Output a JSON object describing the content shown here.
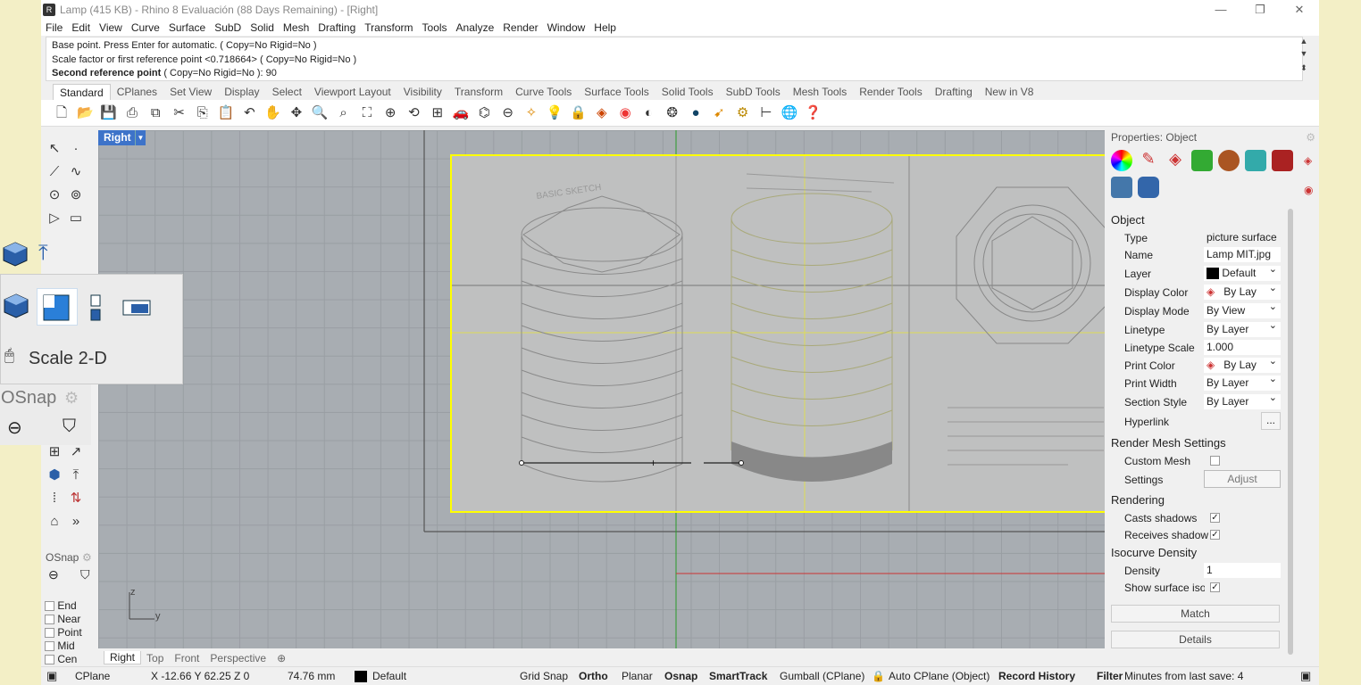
{
  "window": {
    "title": "Lamp (415 KB) - Rhino 8 Evaluación (88 Days Remaining) - [Right]",
    "controls": [
      "—",
      "❐",
      "✕"
    ]
  },
  "menu": [
    "File",
    "Edit",
    "View",
    "Curve",
    "Surface",
    "SubD",
    "Solid",
    "Mesh",
    "Drafting",
    "Transform",
    "Tools",
    "Analyze",
    "Render",
    "Window",
    "Help"
  ],
  "command": {
    "line1": "Base point. Press Enter for automatic. ( Copy=No  Rigid=No )",
    "line2": "Scale factor or first reference point <0.718664> ( Copy=No  Rigid=No )",
    "prompt_bold": "Second reference point",
    "prompt_rest": " ( Copy=No  Rigid=No ): 90"
  },
  "toolbar_tabs": [
    "Standard",
    "CPlanes",
    "Set View",
    "Display",
    "Select",
    "Viewport Layout",
    "Visibility",
    "Transform",
    "Curve Tools",
    "Surface Tools",
    "Solid Tools",
    "SubD Tools",
    "Mesh Tools",
    "Render Tools",
    "Drafting",
    "New in V8"
  ],
  "toolbar_icons": [
    "new-icon",
    "open-icon",
    "save-icon",
    "print-icon",
    "import-icon",
    "cut-icon",
    "copy-icon",
    "paste-icon",
    "undo-icon",
    "pan-icon",
    "rotate-icon",
    "zoom-icon",
    "zoom-window-icon",
    "zoom-extents-icon",
    "zoom-selected-icon",
    "rotate-view-icon",
    "four-view-icon",
    "car-icon",
    "mesh-icon",
    "cplane-icon",
    "osnap-icon",
    "light-icon",
    "lock-icon",
    "layer-icon",
    "color-wheel-icon",
    "material-icon",
    "environment-icon",
    "render-sphere-icon",
    "cursor-icon",
    "gear-icon",
    "dimension-icon",
    "globe-icon",
    "help-icon"
  ],
  "viewport": {
    "name": "Right",
    "tabs": [
      "Right",
      "Top",
      "Front",
      "Perspective"
    ],
    "axis_z": "z",
    "axis_y": "y"
  },
  "flyout": {
    "label": "Scale 2-D",
    "osnap_label": "OSnap"
  },
  "osnap": {
    "title": "OSnap",
    "items": [
      "End",
      "Near",
      "Point",
      "Mid",
      "Cen"
    ]
  },
  "status": {
    "cplane": "CPlane",
    "coords": "X -12.66 Y 62.25 Z 0",
    "distance": "74.76 mm",
    "layer": "Default",
    "grid_snap": "Grid Snap",
    "ortho": "Ortho",
    "planar": "Planar",
    "osnap": "Osnap",
    "smarttrack": "SmartTrack",
    "gumball": "Gumball (CPlane)",
    "auto_cplane": "Auto CPlane (Object)",
    "record_history": "Record History",
    "filter": "Filter",
    "minutes": "Minutes from last save: 4"
  },
  "properties": {
    "header": "Properties: Object",
    "object_section": "Object",
    "type_label": "Type",
    "type_value": "picture surface",
    "name_label": "Name",
    "name_value": "Lamp MIT.jpg",
    "layer_label": "Layer",
    "layer_value": "Default",
    "display_color_label": "Display Color",
    "display_color_value": "By Lay",
    "display_mode_label": "Display Mode",
    "display_mode_value": "By View",
    "linetype_label": "Linetype",
    "linetype_value": "By Layer",
    "linetype_scale_label": "Linetype Scale",
    "linetype_scale_value": "1.000",
    "print_color_label": "Print Color",
    "print_color_value": "By Lay",
    "print_width_label": "Print Width",
    "print_width_value": "By Layer",
    "section_style_label": "Section Style",
    "section_style_value": "By Layer",
    "hyperlink_label": "Hyperlink",
    "hyperlink_btn": "...",
    "render_mesh_section": "Render Mesh Settings",
    "custom_mesh_label": "Custom Mesh",
    "settings_label": "Settings",
    "adjust_btn": "Adjust",
    "rendering_section": "Rendering",
    "casts_shadows_label": "Casts shadows",
    "receives_shadow_label": "Receives shadow",
    "isocurve_section": "Isocurve Density",
    "density_label": "Density",
    "density_value": "1",
    "show_iso_label": "Show surface isoc",
    "match_btn": "Match",
    "details_btn": "Details"
  },
  "sketch_text": {
    "basic_sketch": "BASIC SKETCH"
  },
  "colors": {
    "viewport_bg": "#a8adb2",
    "selection": "#ffff00",
    "viewport_tab": "#3d73c9"
  }
}
